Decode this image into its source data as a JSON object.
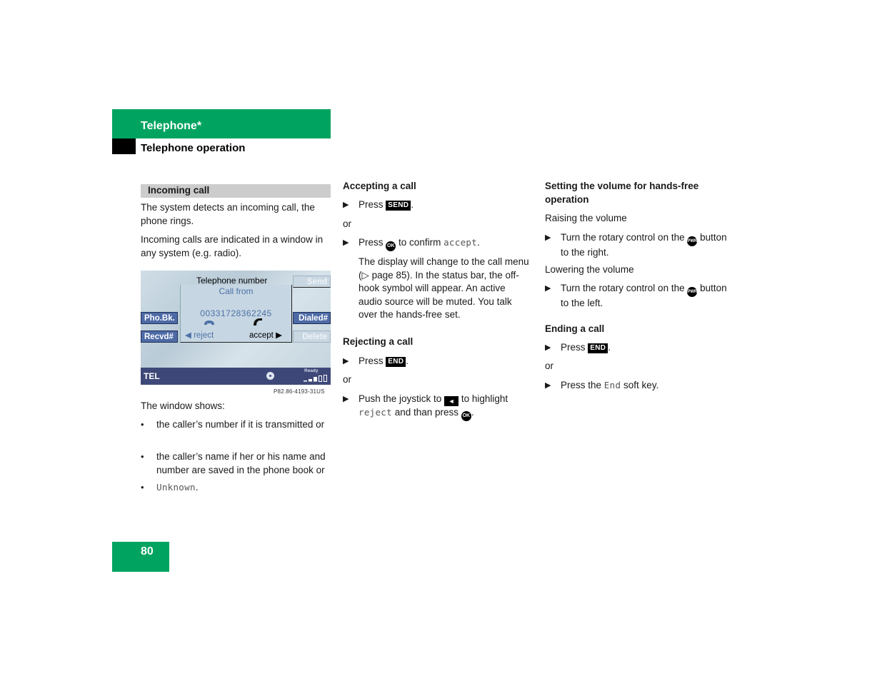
{
  "header": {
    "chapter": "Telephone*",
    "section": "Telephone operation"
  },
  "column1": {
    "section_bar": "Incoming call",
    "para1": "The system detects an incoming call, the phone rings.",
    "para2": "Incoming calls are indicated in a window in any system (e.g. radio).",
    "figure": {
      "title": "Telephone number",
      "popup_title": "Call from",
      "number": "00331728362245",
      "reject_label": "reject",
      "accept_label": "accept",
      "softkeys": {
        "left_top": "Pho.Bk.",
        "left_bottom": "Recvd#",
        "right_top": "Send",
        "right_middle": "Dialed#",
        "right_bottom": "Delete"
      },
      "status_label": "TEL",
      "status_ready": "Ready",
      "signal_level": "3 of 5",
      "code": "P82.86-4193-31US"
    },
    "window_shows": "The window shows:",
    "bullets": [
      "the caller’s number if it is transmitted or",
      "the caller’s name if her or his name and number are saved in the phone book or",
      "Unknown"
    ]
  },
  "column2": {
    "accept_heading": "Accepting a call",
    "accept_step1_prefix": "Press",
    "key_send": "SEND",
    "or1": "or",
    "accept_step2_prefix": "Press",
    "key_ok": "OK",
    "accept_step2_mid": "to confirm",
    "accept_step2_code": "accept",
    "accept_note": "The display will change to the call menu (▷ page 85). In the status bar, the off-hook symbol will appear. An active audio source will be muted. You talk over the hands-free set.",
    "reject_heading": "Rejecting a call",
    "reject_step1_prefix": "Press",
    "key_end": "END",
    "or2": "or",
    "reject_step2_prefix": "Push the joystick to",
    "key_left": "◄",
    "reject_step2_mid": "to highlight",
    "reject_step2_code": "reject",
    "reject_step2_suffix": "and than press"
  },
  "column3": {
    "volume_heading": "Setting the volume for hands-free operation",
    "raising": "Raising the volume",
    "raise_step_prefix": "Turn the rotary control on the",
    "key_pwr": "PWR",
    "raise_step_suffix": "button to the right.",
    "lowering": "Lowering the volume",
    "lower_step_prefix": "Turn the rotary control on the",
    "lower_step_suffix": "button to the left.",
    "ending_heading": "Ending a call",
    "end_step1_prefix": "Press",
    "key_end": "END",
    "or": "or",
    "end_step2_prefix": "Press the",
    "end_step2_code": "End",
    "end_step2_suffix": "soft key."
  },
  "footer": {
    "page_number": "80"
  },
  "colors": {
    "brand_green": "#00a460",
    "section_gray": "#cccccc",
    "screen_status_bar": "#3e4878",
    "screen_accent_blue": "#4d72a8"
  }
}
